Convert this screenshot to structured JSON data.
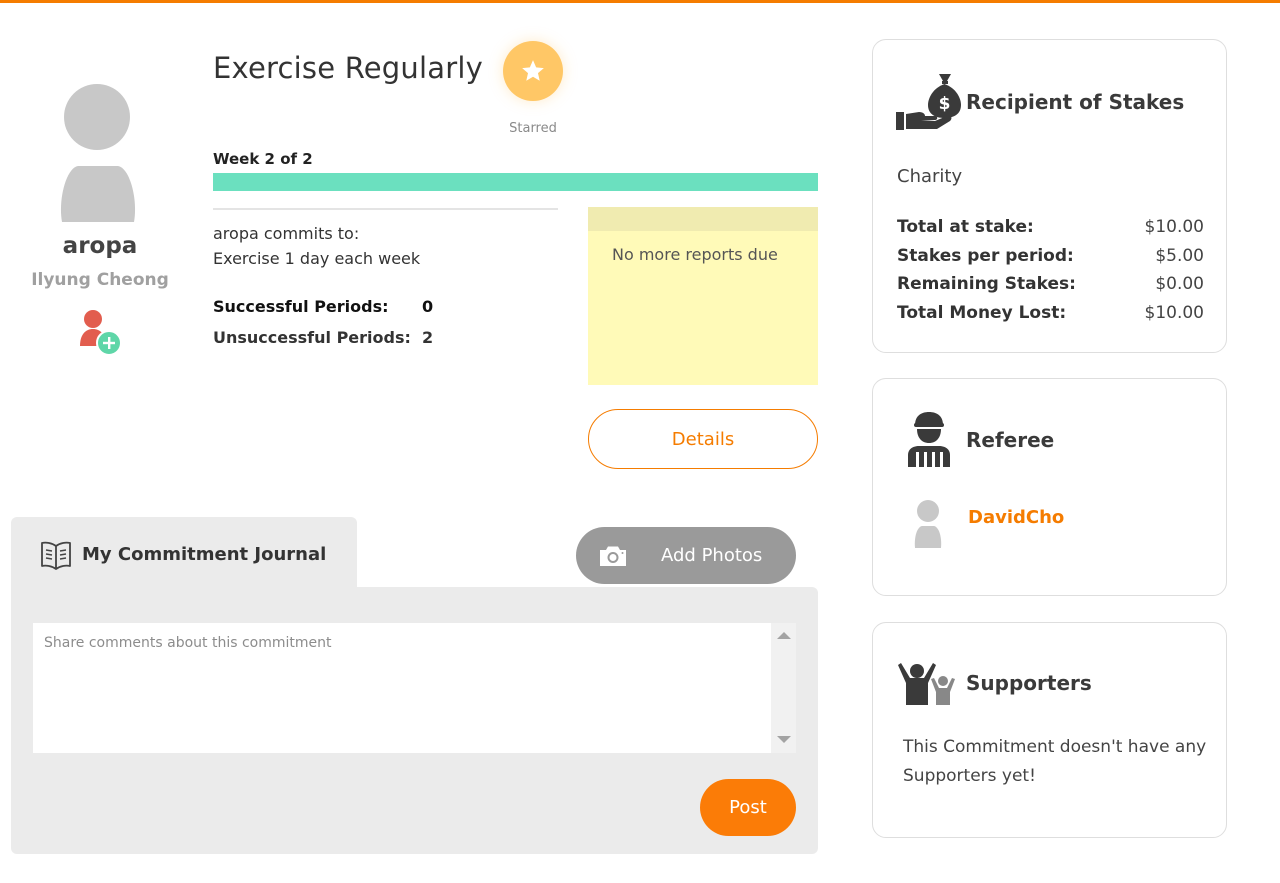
{
  "profile": {
    "username": "aropa",
    "full_name": "Ilyung Cheong"
  },
  "commitment": {
    "title": "Exercise Regularly",
    "star_label": "Starred",
    "week_label": "Week 2 of 2",
    "progress_fraction": 1.0,
    "commits_to_label": "aropa commits to:",
    "commit_text": "Exercise 1 day each week",
    "successful_label": "Successful Periods:",
    "successful_value": "0",
    "unsuccessful_label": "Unsuccessful Periods:",
    "unsuccessful_value": "2",
    "note_text": "No more reports due",
    "details_label": "Details"
  },
  "journal": {
    "title": "My Commitment Journal",
    "add_photos_label": "Add Photos",
    "comment_placeholder": "Share comments about this commitment",
    "post_label": "Post"
  },
  "stakes": {
    "title": "Recipient of Stakes",
    "recipient": "Charity",
    "rows": [
      {
        "label": "Total at stake:",
        "value": "$10.00"
      },
      {
        "label": "Stakes per period:",
        "value": "$5.00"
      },
      {
        "label": "Remaining Stakes:",
        "value": "$0.00"
      },
      {
        "label": "Total Money Lost:",
        "value": "$10.00"
      }
    ]
  },
  "referee": {
    "title": "Referee",
    "name": "DavidCho"
  },
  "supporters": {
    "title": "Supporters",
    "empty_text": "This Commitment doesn't have any Supporters yet!"
  },
  "colors": {
    "accent": "#f57c00",
    "progress": "#6be0bf",
    "star": "#ffc766",
    "note": "#fffab8"
  }
}
